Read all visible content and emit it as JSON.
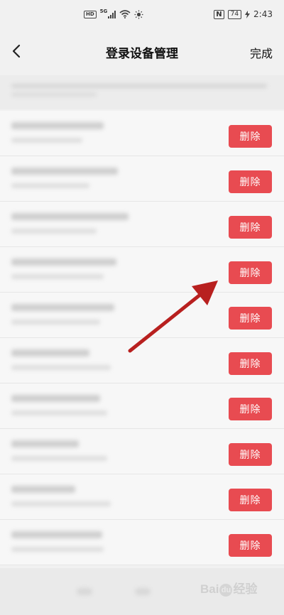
{
  "status_bar": {
    "hd": "HD",
    "network": "5G",
    "nfc": "N",
    "battery": "74",
    "time": "2:43"
  },
  "nav": {
    "title": "登录设备管理",
    "done_label": "完成"
  },
  "notice": {
    "text": ""
  },
  "devices": [
    {
      "delete_label": "删除"
    },
    {
      "delete_label": "删除"
    },
    {
      "delete_label": "删除"
    },
    {
      "delete_label": "删除"
    },
    {
      "delete_label": "删除"
    },
    {
      "delete_label": "删除"
    },
    {
      "delete_label": "删除"
    },
    {
      "delete_label": "删除"
    },
    {
      "delete_label": "删除"
    },
    {
      "delete_label": "删除"
    }
  ],
  "watermark": {
    "text_a": "Bai",
    "paw": "du",
    "text_b": "经验"
  },
  "colors": {
    "delete_button": "#e84b51",
    "annotation_arrow": "#b8201f",
    "background": "#f1f1f1"
  },
  "icons": {
    "back": "chevron-left-icon",
    "arrow": "annotation-arrow-icon"
  }
}
